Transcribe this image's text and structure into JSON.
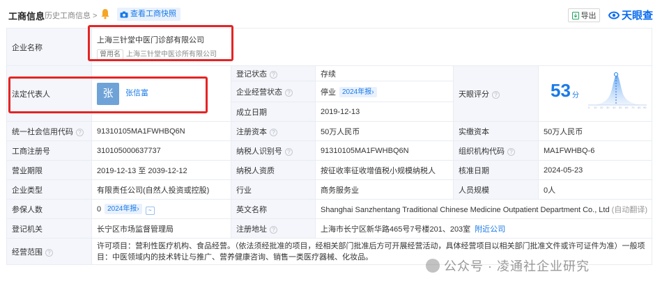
{
  "header": {
    "title": "工商信息",
    "history_link": "历史工商信息 >",
    "snapshot_button": "查看工商快照",
    "export_button": "导出",
    "brand": "天眼查"
  },
  "company_name": {
    "label": "企业名称",
    "value": "上海三针堂中医门诊部有限公司",
    "former_tag": "曾用名",
    "former_name": "上海三针堂中医诊所有限公司"
  },
  "legal_rep": {
    "label": "法定代表人",
    "avatar_char": "张",
    "name": "张信富"
  },
  "reg_status": {
    "label": "登记状态",
    "value": "存续"
  },
  "biz_status": {
    "label": "企业经营状态",
    "value": "停业",
    "badge": "2024年报›"
  },
  "founded": {
    "label": "成立日期",
    "value": "2019-12-13"
  },
  "tianyan_score": {
    "label": "天眼评分",
    "value": "53",
    "unit": "分"
  },
  "rows": [
    {
      "c1_label": "统一社会信用代码",
      "c1_value": "91310105MA1FWHBQ6N",
      "c2_label": "注册资本",
      "c2_value": "50万人民币",
      "c3_label": "实缴资本",
      "c3_value": "50万人民币"
    },
    {
      "c1_label": "工商注册号",
      "c1_value": "310105000637737",
      "c2_label": "纳税人识别号",
      "c2_value": "91310105MA1FWHBQ6N",
      "c3_label": "组织机构代码",
      "c3_value": "MA1FWHBQ-6"
    },
    {
      "c1_label": "营业期限",
      "c1_value": "2019-12-13 至 2039-12-12",
      "c2_label": "纳税人资质",
      "c2_value": "按征收率征收增值税小规模纳税人",
      "c3_label": "核准日期",
      "c3_value": "2024-05-23"
    },
    {
      "c1_label": "企业类型",
      "c1_value": "有限责任公司(自然人投资或控股)",
      "c2_label": "行业",
      "c2_value": "商务服务业",
      "c3_label": "人员规模",
      "c3_value": "0人"
    }
  ],
  "insured": {
    "label": "参保人数",
    "value": "0",
    "badge": "2024年报›"
  },
  "english_name": {
    "label": "英文名称",
    "value": "Shanghai Sanzhentang Traditional Chinese Medicine Outpatient Department Co., Ltd",
    "note": "(自动翻译)"
  },
  "authority": {
    "label": "登记机关",
    "value": "长宁区市场监督管理局"
  },
  "address": {
    "label": "注册地址",
    "value": "上海市长宁区新华路465号7号楼201、203室",
    "link": "附近公司"
  },
  "scope": {
    "label": "经营范围",
    "value": "许可项目：营利性医疗机构、食品经营。（依法须经批准的项目，经相关部门批准后方可开展经营活动，具体经营项目以相关部门批准文件或许可证件为准）一般项目：中医领域内的技术转让与推广、营养健康咨询、销售一类医疗器械、化妆品。"
  },
  "watermark": "公众号 · 凌通社企业研究",
  "colors": {
    "accent": "#1a7ae8",
    "label_bg": "#f4f6fb",
    "status_green": "#1fa45d",
    "highlight_red": "#e42424"
  }
}
